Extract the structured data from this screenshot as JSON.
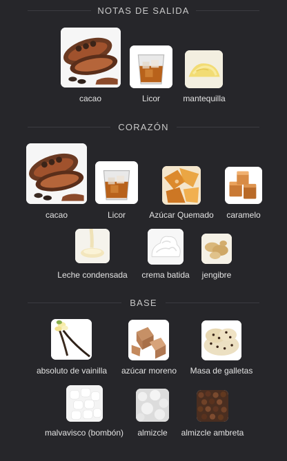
{
  "sections": [
    {
      "title": "NOTAS DE SALIDA",
      "notes": [
        {
          "label": "cacao",
          "icon": "cacao-image"
        },
        {
          "label": "Licor",
          "icon": "liquor-glass-image"
        },
        {
          "label": "mantequilla",
          "icon": "butter-image"
        }
      ]
    },
    {
      "title": "CORAZÓN",
      "notes": [
        {
          "label": "cacao",
          "icon": "cacao-image"
        },
        {
          "label": "Licor",
          "icon": "liquor-glass-image"
        },
        {
          "label": "Azúcar Quemado",
          "icon": "burnt-sugar-image"
        },
        {
          "label": "caramelo",
          "icon": "caramel-image"
        },
        {
          "label": "Leche condensada",
          "icon": "condensed-milk-image"
        },
        {
          "label": "crema batida",
          "icon": "whipped-cream-image"
        },
        {
          "label": "jengibre",
          "icon": "ginger-image"
        }
      ]
    },
    {
      "title": "BASE",
      "notes": [
        {
          "label": "absoluto de vainilla",
          "icon": "vanilla-image"
        },
        {
          "label": "azúcar moreno",
          "icon": "brown-sugar-image"
        },
        {
          "label": "Masa de galletas",
          "icon": "cookie-dough-image"
        },
        {
          "label": "malvavisco (bombón)",
          "icon": "marshmallow-image"
        },
        {
          "label": "almizcle",
          "icon": "musk-image"
        },
        {
          "label": "almizcle ambreta",
          "icon": "ambrette-seed-image"
        }
      ]
    }
  ],
  "colors": {
    "background": "#26262a",
    "text": "#e4e4e4",
    "divider": "#3c3c41"
  }
}
